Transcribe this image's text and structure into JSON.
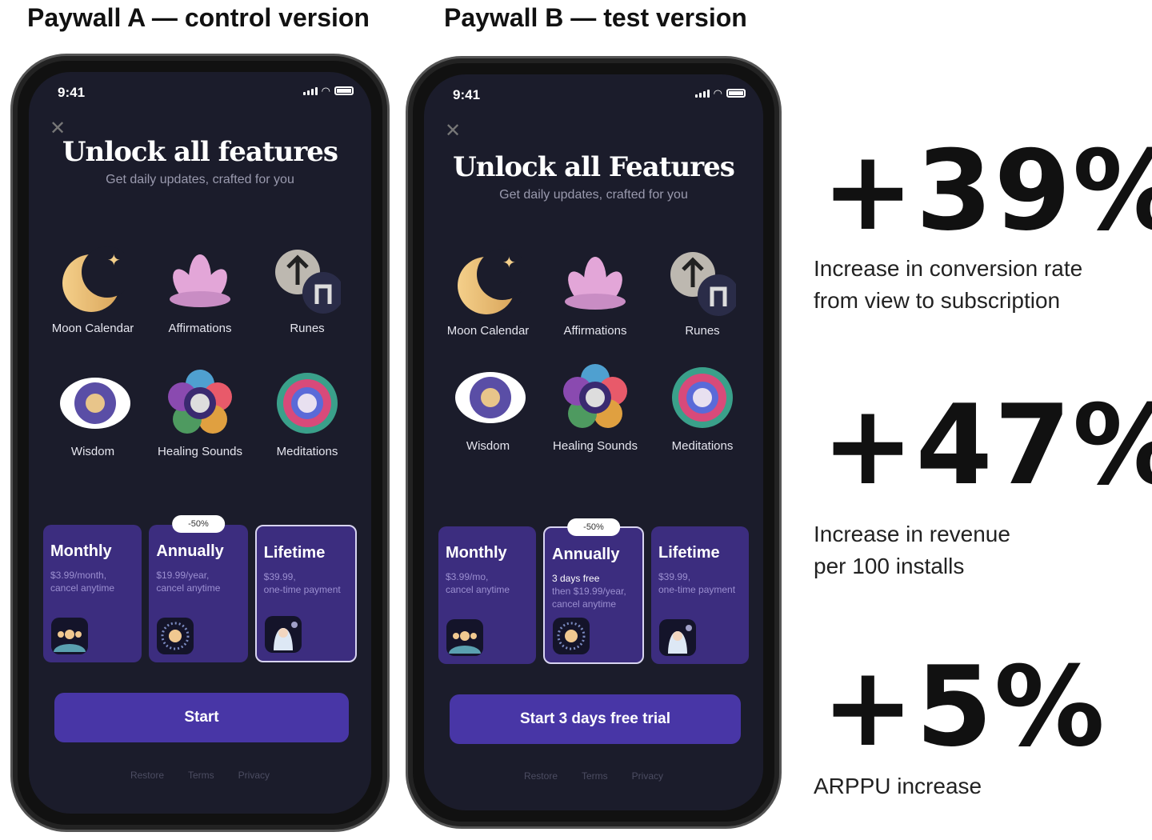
{
  "headings": {
    "a": "Paywall A — control version",
    "b": "Paywall B — test version"
  },
  "phones": [
    {
      "time": "9:41",
      "title": "Unlock all features",
      "subtitle": "Get daily updates, crafted for you",
      "features": [
        "Moon Calendar",
        "Affirmations",
        "Runes",
        "Wisdom",
        "Healing Sounds",
        "Meditations"
      ],
      "plans": [
        {
          "name": "Monthly",
          "lines": [
            "$3.99/month,",
            "cancel anytime"
          ]
        },
        {
          "name": "Annually",
          "badge": "-50%",
          "lines": [
            "$19.99/year,",
            "cancel anytime"
          ]
        },
        {
          "name": "Lifetime",
          "lines": [
            "$39.99,",
            "one-time payment"
          ],
          "selected": true
        }
      ],
      "cta": "Start",
      "links": [
        "Restore",
        "Terms",
        "Privacy"
      ]
    },
    {
      "time": "9:41",
      "title": "Unlock all Features",
      "subtitle": "Get daily updates, crafted for you",
      "features": [
        "Moon Calendar",
        "Affirmations",
        "Runes",
        "Wisdom",
        "Healing Sounds",
        "Meditations"
      ],
      "plans": [
        {
          "name": "Monthly",
          "lines": [
            "$3.99/mo,",
            "cancel anytime"
          ]
        },
        {
          "name": "Annually",
          "badge": "-50%",
          "highlight": "3 days free",
          "lines": [
            "then $19.99/year,",
            "cancel anytime"
          ],
          "selected": true
        },
        {
          "name": "Lifetime",
          "lines": [
            "$39.99,",
            "one-time payment"
          ]
        }
      ],
      "cta": "Start 3 days free trial",
      "links": [
        "Restore",
        "Terms",
        "Privacy"
      ]
    }
  ],
  "metrics": [
    {
      "value": "+39%",
      "desc1": "Increase in conversion rate",
      "desc2": "from view to subscription"
    },
    {
      "value": "+47%",
      "desc1": "Increase in revenue",
      "desc2": "per 100 installs"
    },
    {
      "value": "+5%",
      "desc1": "ARPPU increase",
      "desc2": ""
    }
  ],
  "colors": {
    "screen": "#1b1c2b",
    "card": "#3c2d7f",
    "cta": "#4836a6"
  }
}
